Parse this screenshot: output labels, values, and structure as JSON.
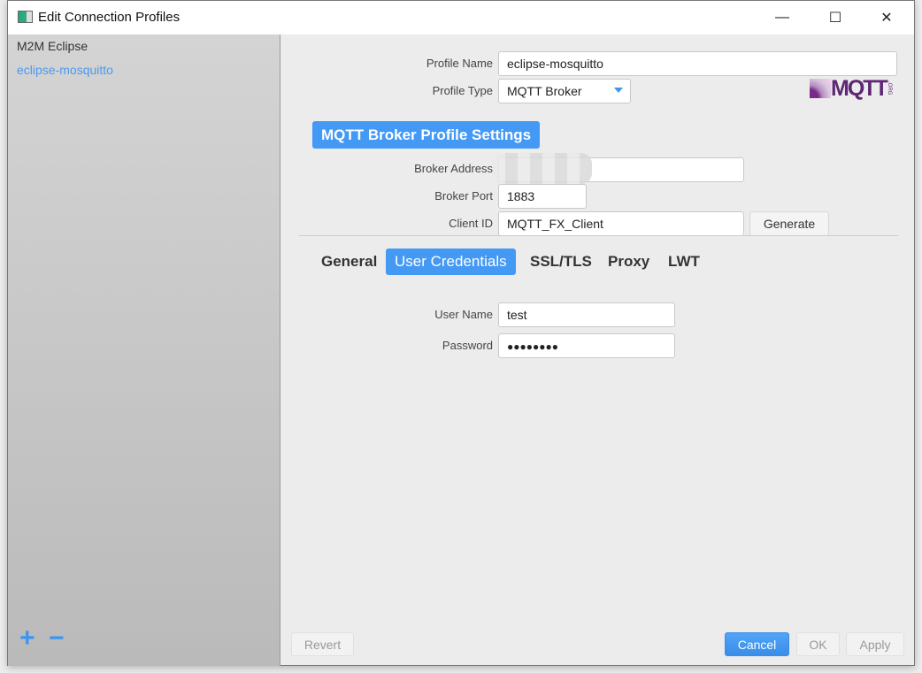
{
  "window": {
    "title": "Edit Connection Profiles",
    "minimize": "—",
    "maximize": "☐",
    "close": "✕"
  },
  "sidebar": {
    "items": [
      {
        "label": "M2M Eclipse",
        "selected": false
      },
      {
        "label": "eclipse-mosquitto",
        "selected": true
      }
    ],
    "add": "+",
    "remove": "−"
  },
  "profile": {
    "name_label": "Profile Name",
    "name_value": "eclipse-mosquitto",
    "type_label": "Profile Type",
    "type_value": "MQTT Broker",
    "logo_text": "MQTT",
    "logo_suffix": ".ORG"
  },
  "section": {
    "title": "MQTT Broker Profile Settings"
  },
  "broker": {
    "address_label": "Broker Address",
    "address_value": "",
    "port_label": "Broker Port",
    "port_value": "1883",
    "client_id_label": "Client ID",
    "client_id_value": "MQTT_FX_Client",
    "generate": "Generate"
  },
  "tabs": [
    {
      "label": "General",
      "active": false
    },
    {
      "label": "User Credentials",
      "active": true
    },
    {
      "label": "SSL/TLS",
      "active": false
    },
    {
      "label": "Proxy",
      "active": false
    },
    {
      "label": "LWT",
      "active": false
    }
  ],
  "credentials": {
    "user_label": "User Name",
    "user_value": "test",
    "password_label": "Password",
    "password_mask": "●●●●●●●●"
  },
  "footer": {
    "revert": "Revert",
    "cancel": "Cancel",
    "ok": "OK",
    "apply": "Apply"
  },
  "colors": {
    "accent": "#4499f5",
    "selected_text": "#4a9af0"
  }
}
